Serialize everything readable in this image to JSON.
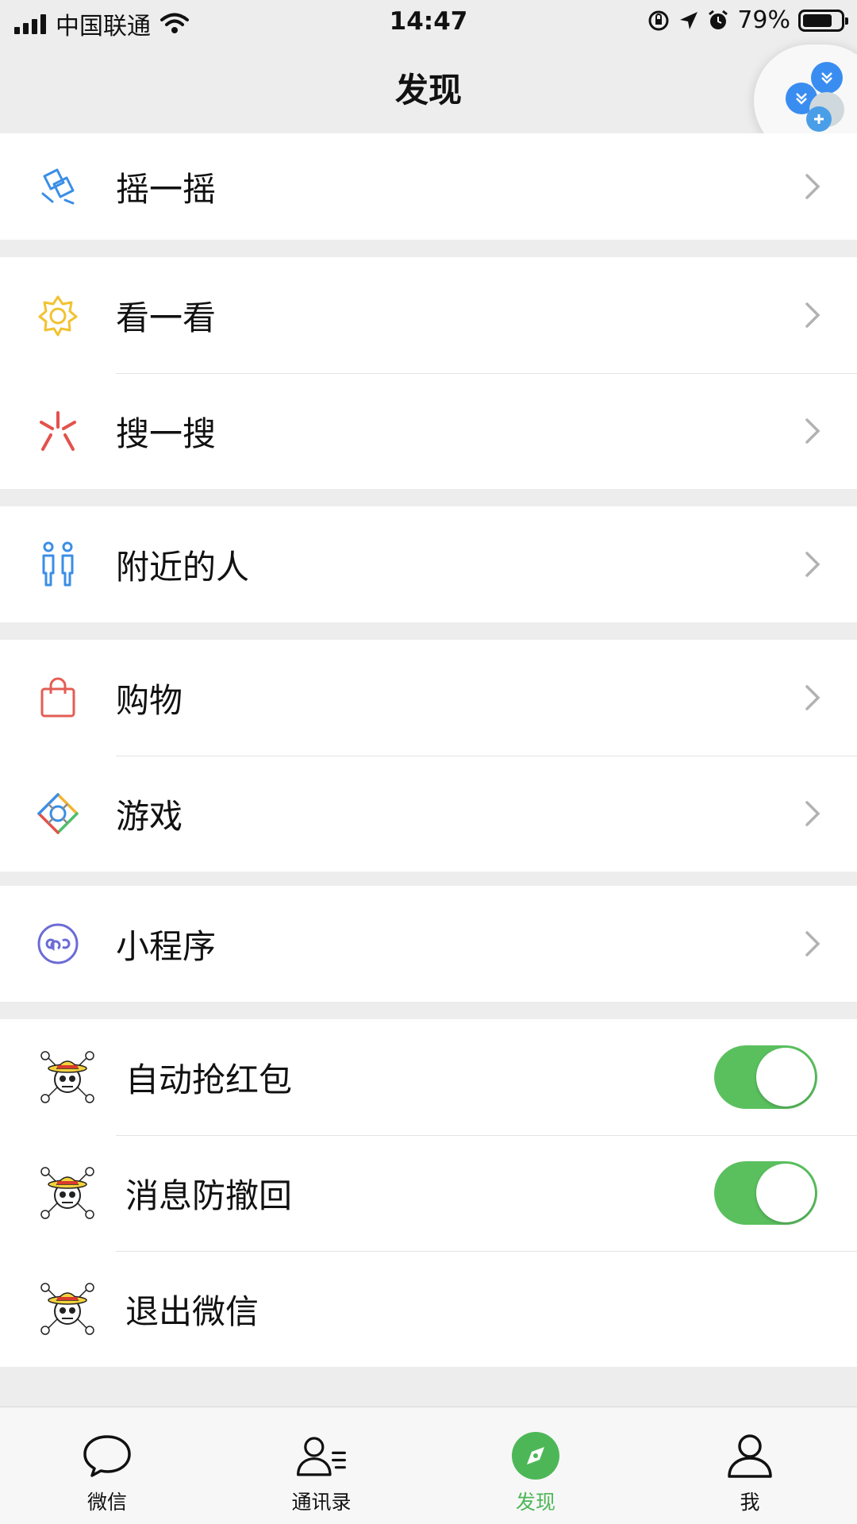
{
  "status_bar": {
    "carrier": "中国联通",
    "time": "14:47",
    "battery": "79%",
    "battery_level": 0.79
  },
  "nav": {
    "title": "发现"
  },
  "groups": [
    {
      "items": [
        {
          "label": "摇一摇",
          "icon": "shake-icon"
        }
      ]
    },
    {
      "items": [
        {
          "label": "看一看",
          "icon": "top-stories-icon"
        },
        {
          "label": "搜一搜",
          "icon": "search-icon"
        }
      ]
    },
    {
      "items": [
        {
          "label": "附近的人",
          "icon": "people-nearby-icon"
        }
      ]
    },
    {
      "items": [
        {
          "label": "购物",
          "icon": "shopping-bag-icon"
        },
        {
          "label": "游戏",
          "icon": "games-icon"
        }
      ]
    },
    {
      "items": [
        {
          "label": "小程序",
          "icon": "mini-program-icon"
        }
      ]
    },
    {
      "items": [
        {
          "label": "自动抢红包",
          "icon": "skull-crossbones-icon",
          "toggle": true
        },
        {
          "label": "消息防撤回",
          "icon": "skull-crossbones-icon",
          "toggle": true
        },
        {
          "label": "退出微信",
          "icon": "skull-crossbones-icon"
        }
      ]
    }
  ],
  "tabbar": {
    "tabs": [
      {
        "label": "微信",
        "icon": "chat-bubble-icon"
      },
      {
        "label": "通讯录",
        "icon": "contacts-icon"
      },
      {
        "label": "发现",
        "icon": "compass-icon",
        "active": true
      },
      {
        "label": "我",
        "icon": "profile-icon"
      }
    ]
  },
  "colors": {
    "accent": "#4db757",
    "toggle_on": "#5ac05e",
    "background": "#ededed"
  }
}
